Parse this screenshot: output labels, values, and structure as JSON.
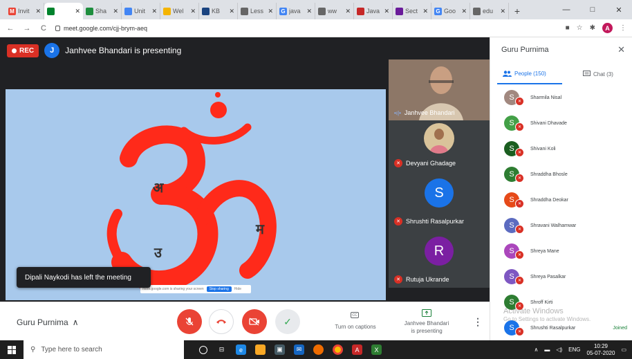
{
  "browser": {
    "tabs": [
      {
        "icon": "gmail-icon",
        "label": "Invit",
        "color": "#ea4335",
        "glyph": "M"
      },
      {
        "icon": "meet-icon",
        "label": "",
        "color": "#00832d",
        "glyph": "",
        "active": true
      },
      {
        "icon": "drive-icon",
        "label": "Sha",
        "color": "#1e8e3e",
        "glyph": ""
      },
      {
        "icon": "forms-icon",
        "label": "Unit",
        "color": "#4285f4",
        "glyph": ""
      },
      {
        "icon": "slides-icon",
        "label": "Wel",
        "color": "#f4b400",
        "glyph": ""
      },
      {
        "icon": "kb-icon",
        "label": "KB",
        "color": "#1a4480",
        "glyph": ""
      },
      {
        "icon": "globe-icon",
        "label": "Less",
        "color": "#666666",
        "glyph": ""
      },
      {
        "icon": "google-icon",
        "label": "java",
        "color": "#4285f4",
        "glyph": "G"
      },
      {
        "icon": "globe-icon",
        "label": "ww",
        "color": "#666666",
        "glyph": ""
      },
      {
        "icon": "java-icon",
        "label": "Java",
        "color": "#c62828",
        "glyph": ""
      },
      {
        "icon": "sect-icon",
        "label": "Sect",
        "color": "#6a1b9a",
        "glyph": ""
      },
      {
        "icon": "google-icon",
        "label": "Goo",
        "color": "#4285f4",
        "glyph": "G"
      },
      {
        "icon": "globe-icon",
        "label": "edu",
        "color": "#666666",
        "glyph": ""
      }
    ],
    "url": "meet.google.com/cjj-brym-aeq",
    "window_controls": [
      "—",
      "□",
      "✕"
    ]
  },
  "meet": {
    "rec_label": "REC",
    "presenter_initial": "J",
    "presenting_text": "Janhvee Bhandari is presenting",
    "slide": {
      "glyphs": [
        "अ",
        "म",
        "उ"
      ],
      "om_color": "#ff2a1a",
      "bg_color": "#a8c9ec"
    },
    "toast": "Dipali Naykodi has left the meeting",
    "share_bar_text": "meet.google.com is sharing your screen",
    "share_bar_stop": "Stop sharing",
    "share_bar_hide": "Hide",
    "tiles": [
      {
        "name": "Janhvee Bhandari",
        "type": "video"
      },
      {
        "name": "Devyani Ghadage",
        "type": "photo"
      },
      {
        "name": "Shrushti Rasalpurkar",
        "type": "avatar",
        "initial": "S",
        "color": "#1a73e8"
      },
      {
        "name": "Rutuja Ukrande",
        "type": "avatar",
        "initial": "R",
        "color": "#7b1fa2"
      }
    ]
  },
  "callbar": {
    "meeting_name": "Guru Purnima",
    "captions_label": "Turn on captions",
    "captions_icon": "CC",
    "presenting_label_1": "Janhvee Bhandari",
    "presenting_label_2": "is presenting"
  },
  "panel": {
    "title": "Guru Purnima",
    "people_tab": "People (150)",
    "chat_tab": "Chat (3)",
    "participants": [
      {
        "name": "Sharmila Nisal",
        "initial": "S",
        "color": "#a1887f"
      },
      {
        "name": "Shivani Dhavade",
        "initial": "S",
        "color": "#43a047"
      },
      {
        "name": "Shivani Koli",
        "initial": "S",
        "color": "#1b5e20"
      },
      {
        "name": "Shraddha Bhosle",
        "initial": "S",
        "color": "#2e7d32"
      },
      {
        "name": "Shraddha Deokar",
        "initial": "S",
        "color": "#e64a19"
      },
      {
        "name": "Shravani Walhamwar",
        "initial": "S",
        "color": "#5c6bc0"
      },
      {
        "name": "Shreya Mane",
        "initial": "S",
        "color": "#ab47bc"
      },
      {
        "name": "Shreya Pasalkar",
        "initial": "S",
        "color": "#7e57c2"
      },
      {
        "name": "Shroff Kirti",
        "initial": "S",
        "color": "#2e7d32"
      },
      {
        "name": "Shrushti Rasalpurkar",
        "initial": "S",
        "color": "#1a73e8",
        "joined": "Joined"
      }
    ]
  },
  "watermark": {
    "line1": "Activate Windows",
    "line2": "Go to Settings to activate Windows."
  },
  "taskbar": {
    "search_placeholder": "Type here to search",
    "lang": "ENG",
    "time": "10:29",
    "date": "05-07-2020"
  }
}
